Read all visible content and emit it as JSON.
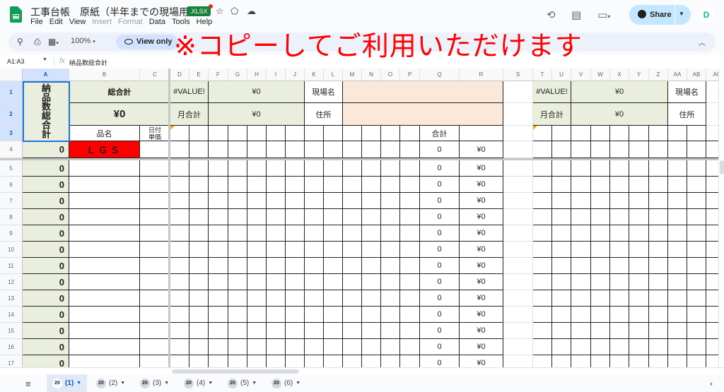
{
  "app": {
    "doc_title": "工事台帳　原紙（半年までの現場用）",
    "file_badge": ".XLSX",
    "menu": [
      {
        "label": "File",
        "disabled": false
      },
      {
        "label": "Edit",
        "disabled": false
      },
      {
        "label": "View",
        "disabled": false
      },
      {
        "label": "Insert",
        "disabled": true
      },
      {
        "label": "Format",
        "disabled": true
      },
      {
        "label": "Data",
        "disabled": false
      },
      {
        "label": "Tools",
        "disabled": false
      },
      {
        "label": "Help",
        "disabled": false
      }
    ],
    "share_label": "Share",
    "avatar_letter": "D"
  },
  "toolbar": {
    "zoom": "100%",
    "view_only_label": "View only"
  },
  "banner_text": "※コピーしてご利用いただけます",
  "formula_bar": {
    "name_box": "A1:A3",
    "fx": "fx",
    "value": "納品数総合計"
  },
  "columns": [
    "A",
    "B",
    "C",
    "D",
    "E",
    "F",
    "G",
    "H",
    "I",
    "J",
    "K",
    "L",
    "M",
    "N",
    "O",
    "P",
    "Q",
    "R",
    "S",
    "T",
    "U",
    "V",
    "W",
    "X",
    "Y",
    "Z",
    "AA",
    "AB",
    "AC"
  ],
  "selected_column": "A",
  "rows": [
    "1",
    "2",
    "3",
    "4",
    "5",
    "6",
    "7",
    "8",
    "9",
    "10",
    "11",
    "12",
    "13",
    "14",
    "15",
    "16",
    "17"
  ],
  "header_cells": {
    "a1_vertical": "納品数総合計",
    "b1": "総合計",
    "b2": "¥0",
    "b3": "品名",
    "c3": "日付\n単価",
    "d1": "#VALUE!",
    "f1": "¥0",
    "d2": "月合計",
    "f2": "¥0",
    "k1": "現場名",
    "k2": "住所",
    "q3": "合計",
    "t1": "#VALUE!",
    "v1": "¥0",
    "t2": "月合計",
    "v2": "¥0",
    "aa1": "現場名",
    "aa2": "住所",
    "a4": "0",
    "b4": "ＬＧＳ",
    "q4": "0",
    "r4": "¥0"
  },
  "data_rows": [
    {
      "row": "5",
      "a": "0",
      "q": "0",
      "r": "¥0"
    },
    {
      "row": "6",
      "a": "0",
      "q": "0",
      "r": "¥0"
    },
    {
      "row": "7",
      "a": "0",
      "q": "0",
      "r": "¥0"
    },
    {
      "row": "8",
      "a": "0",
      "q": "0",
      "r": "¥0"
    },
    {
      "row": "9",
      "a": "0",
      "q": "0",
      "r": "¥0"
    },
    {
      "row": "10",
      "a": "0",
      "q": "0",
      "r": "¥0"
    },
    {
      "row": "11",
      "a": "0",
      "q": "0",
      "r": "¥0"
    },
    {
      "row": "12",
      "a": "0",
      "q": "0",
      "r": "¥0"
    },
    {
      "row": "13",
      "a": "0",
      "q": "0",
      "r": "¥0"
    },
    {
      "row": "14",
      "a": "0",
      "q": "0",
      "r": "¥0"
    },
    {
      "row": "15",
      "a": "0",
      "q": "0",
      "r": "¥0"
    },
    {
      "row": "16",
      "a": "0",
      "q": "0",
      "r": "¥0"
    },
    {
      "row": "17",
      "a": "0",
      "q": "0",
      "r": "¥0"
    }
  ],
  "sheet_tabs": [
    {
      "badge": "20",
      "label": "(1)",
      "active": true
    },
    {
      "badge": "20",
      "label": "(2)",
      "active": false
    },
    {
      "badge": "20",
      "label": "(3)",
      "active": false
    },
    {
      "badge": "20",
      "label": "(4)",
      "active": false
    },
    {
      "badge": "20",
      "label": "(5)",
      "active": false
    },
    {
      "badge": "20",
      "label": "(6)",
      "active": false
    }
  ],
  "colors": {
    "accent": "#0b57d0",
    "cell_green": "#e9efdc",
    "cell_peach": "#fce8d9",
    "cell_red": "#ff0000",
    "banner": "#ff0000"
  }
}
